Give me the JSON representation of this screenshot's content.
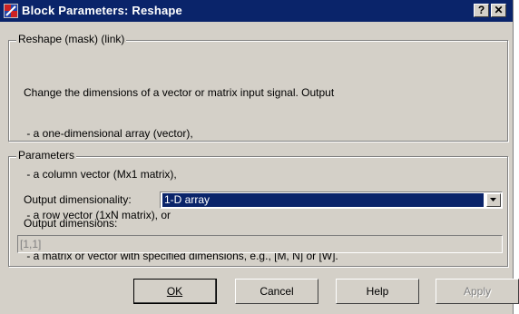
{
  "window": {
    "title": "Block Parameters: Reshape"
  },
  "title_buttons": {
    "help": "?",
    "close": "✕"
  },
  "mask_group": {
    "legend": "Reshape (mask) (link)",
    "description": [
      "Change the dimensions of a vector or matrix input signal. Output",
      " - a one-dimensional array (vector),",
      " - a column vector (Mx1 matrix),",
      " - a row vector (1xN matrix), or",
      " - a matrix or vector with specified dimensions, e.g., [M, N] or [W]."
    ]
  },
  "parameters": {
    "legend": "Parameters",
    "output_dimensionality_label": "Output dimensionality:",
    "output_dimensionality_value": "1-D array",
    "output_dimensions_label": "Output dimensions:",
    "output_dimensions_value": "[1,1]"
  },
  "buttons": {
    "ok": "OK",
    "cancel": "Cancel",
    "help": "Help",
    "apply": "Apply"
  },
  "colors": {
    "titlebar": "#0a246a",
    "face": "#d4d0c8",
    "selection": "#0a246a"
  }
}
